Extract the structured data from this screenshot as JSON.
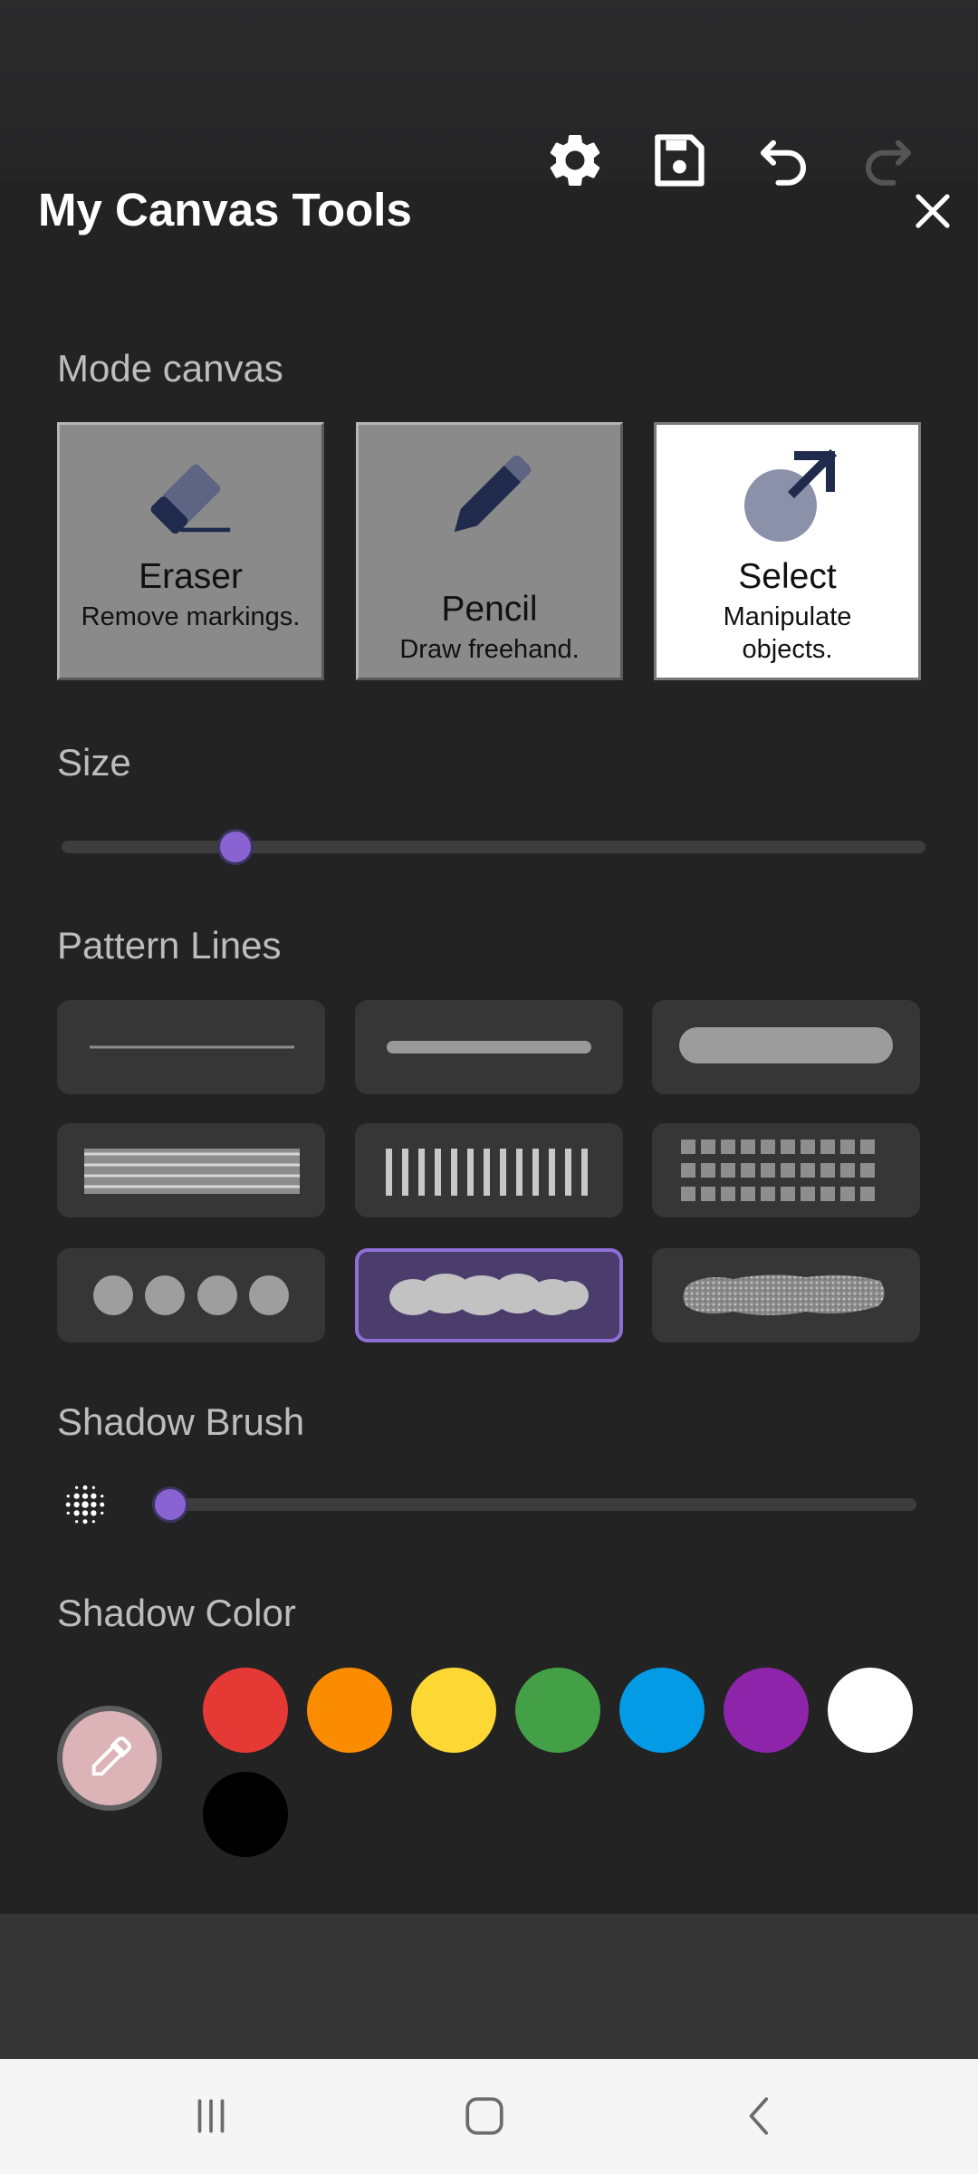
{
  "header": {
    "title": "My Canvas Tools",
    "icons": [
      "gear-icon",
      "save-icon",
      "undo-icon",
      "redo-icon",
      "close-icon"
    ]
  },
  "mode_section": {
    "label": "Mode canvas",
    "modes": [
      {
        "name": "Eraser",
        "desc": "Remove markings.",
        "selected": false
      },
      {
        "name": "Pencil",
        "desc": "Draw freehand.",
        "selected": false
      },
      {
        "name": "Select",
        "desc": "Manipulate objects.",
        "selected": true
      }
    ]
  },
  "size_section": {
    "label": "Size",
    "value": 0.2
  },
  "pattern_section": {
    "label": "Pattern Lines",
    "patterns": [
      "thin-line",
      "medium-line",
      "thick-line",
      "horizontal-stripes",
      "vertical-stripes",
      "grid",
      "dots",
      "cloud",
      "spray"
    ],
    "selected": "cloud"
  },
  "shadow_brush_section": {
    "label": "Shadow Brush",
    "value": 0.02
  },
  "shadow_color_section": {
    "label": "Shadow Color",
    "eyedropper_color": "#dcb4b7",
    "colors": [
      "#e53935",
      "#fb8c00",
      "#fdd835",
      "#43a047",
      "#039be5",
      "#8e24aa",
      "#ffffff",
      "#000000"
    ]
  },
  "system_nav": {
    "icons": [
      "recents-icon",
      "home-icon",
      "back-icon"
    ]
  }
}
